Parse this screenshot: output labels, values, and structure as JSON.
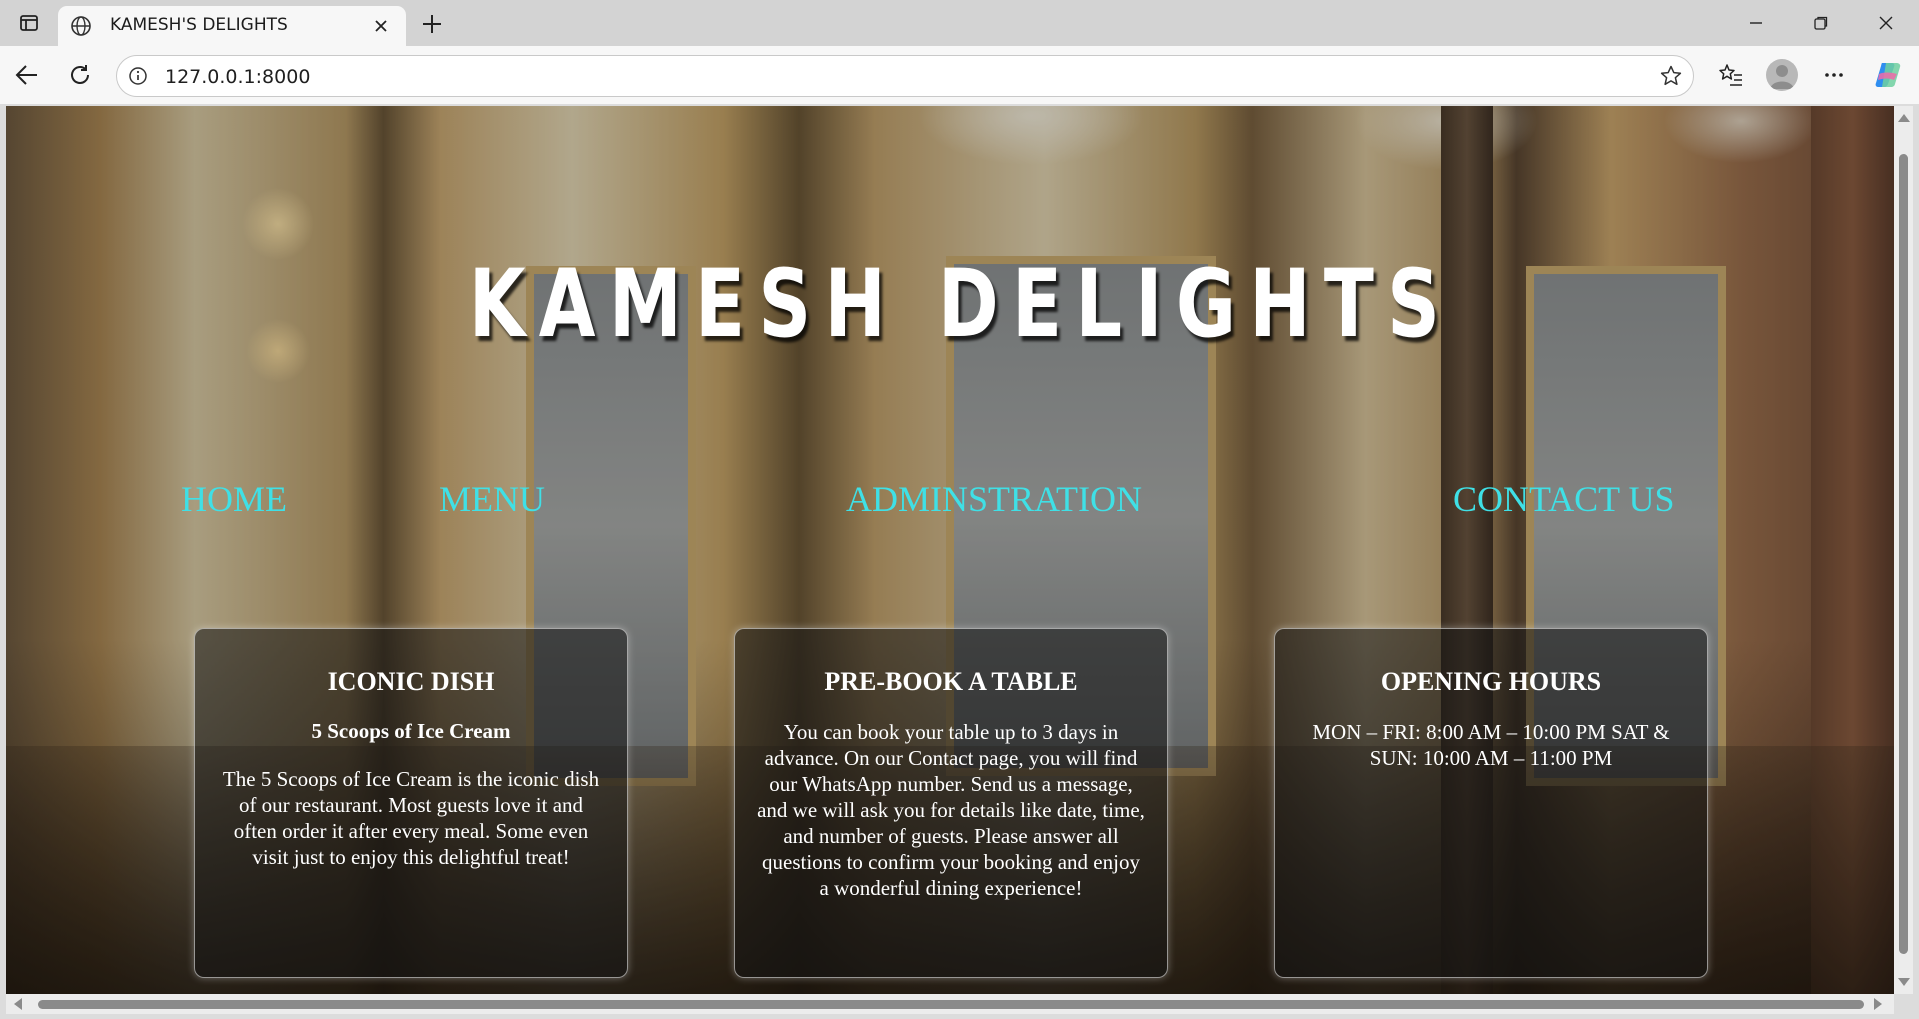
{
  "browser": {
    "tab_title": "KAMESH'S DELIGHTS",
    "url": "127.0.0.1:8000",
    "icons": [
      "tab-actions-icon",
      "globe-icon",
      "close-icon",
      "plus-icon",
      "minimize-icon",
      "restore-icon",
      "window-close-icon",
      "back-arrow-icon",
      "reload-icon",
      "info-icon",
      "star-icon",
      "favorites-icon",
      "profile-icon",
      "more-icon",
      "copilot-icon"
    ]
  },
  "page": {
    "title": "KAMESH DELIGHTS",
    "nav": [
      "HOME",
      "MENU",
      "ADMINSTRATION",
      "CONTACT US"
    ],
    "cards": [
      {
        "heading": "ICONIC DISH",
        "subheading": "5 Scoops of Ice Cream",
        "body": "The 5 Scoops of Ice Cream is the iconic dish of our restaurant. Most guests love it and often order it after every meal. Some even visit just to enjoy this delightful treat!"
      },
      {
        "heading": "PRE-BOOK A TABLE",
        "body": "You can book your table up to 3 days in advance. On our Contact page, you will find our WhatsApp number. Send us a message, and we will ask you for details like date, time, and number of guests. Please answer all questions to confirm your booking and enjoy a wonderful dining experience!"
      },
      {
        "heading": "OPENING HOURS",
        "body": "MON – FRI: 8:00 AM – 10:00 PM SAT & SUN: 10:00 AM – 11:00 PM"
      }
    ],
    "colors": {
      "nav_link": "#3fe0e6",
      "title": "#ffffff",
      "card_bg": "rgba(20,20,20,0.55)"
    }
  }
}
